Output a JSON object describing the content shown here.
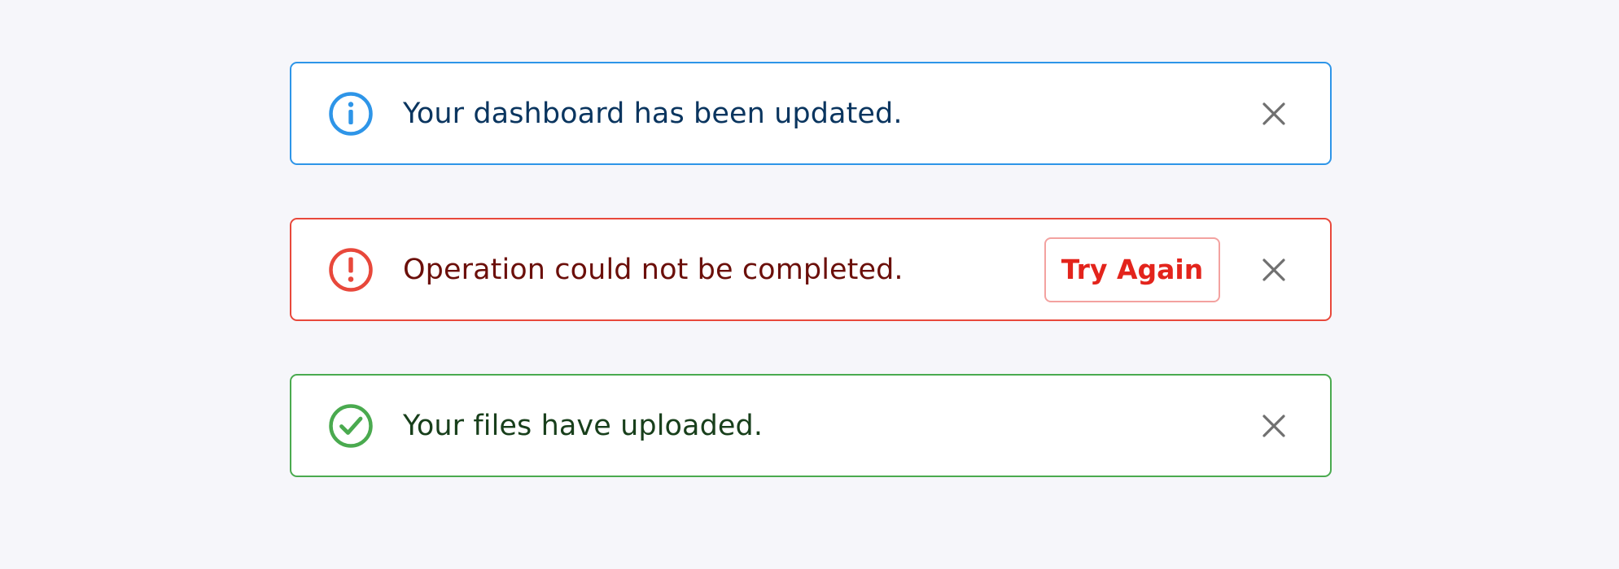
{
  "colors": {
    "page_background": "#f6f6fa",
    "info_border": "#2e95e8",
    "info_text": "#0a355f",
    "error_border": "#e8483b",
    "error_text": "#6b0f0a",
    "error_action_border": "#f3a2a0",
    "error_action_text": "#e3241c",
    "success_border": "#4aaa4f",
    "success_text": "#183f1b",
    "close_icon": "#707070"
  },
  "alerts": [
    {
      "variant": "info",
      "icon": "info-circle-icon",
      "message": "Your dashboard has been updated.",
      "close_icon": "close-icon"
    },
    {
      "variant": "error",
      "icon": "exclamation-circle-icon",
      "message": "Operation could not be completed.",
      "action_label": "Try Again",
      "close_icon": "close-icon"
    },
    {
      "variant": "success",
      "icon": "check-circle-icon",
      "message": "Your files have uploaded.",
      "close_icon": "close-icon"
    }
  ]
}
